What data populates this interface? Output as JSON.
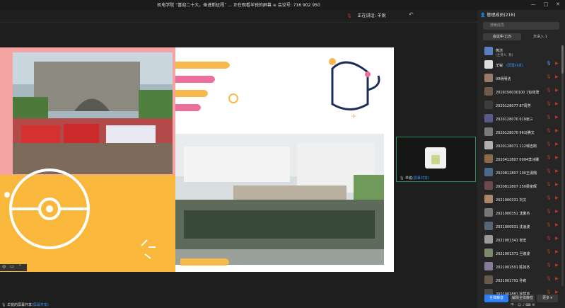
{
  "window": {
    "title": "机电学院 “喜迎二十大，奋进新征程” ... 正在观看羊锐的屏幕  ≡  会议号: 716 902 950",
    "minimize": "—",
    "maximize": "□",
    "close": "✕"
  },
  "top": {
    "speaking_label": "正在讲话: 羊锐",
    "undo_icon": "↶"
  },
  "selfview": {
    "name": "羊锐",
    "sharing_tag": "(屏幕共享)"
  },
  "status": {
    "text": "羊锐的屏幕共享",
    "tag": "(屏幕共享)"
  },
  "bottom_left_icons": [
    "◎",
    "▭",
    "⌃"
  ],
  "panel": {
    "title": "管理成员(216)",
    "search_placeholder": "搜索成员",
    "tab_in_meeting": "会议中·215",
    "tab_not_joined": "未进入·1",
    "members": [
      {
        "name": "熊洁",
        "sub": "(主持人, 我)",
        "avatar": "#5a7fbf"
      },
      {
        "name": "羊锐",
        "sub": "(屏幕共享)",
        "avatar": "#dcdcdc",
        "tag": true
      },
      {
        "name": "09杨明洁",
        "sub": "",
        "avatar": "#9a7b6b"
      },
      {
        "name": "2019156030100 1包佳澄",
        "sub": "",
        "avatar": "#6d5a4a"
      },
      {
        "name": "2020128077 87周芳",
        "sub": "",
        "avatar": "#3c3c3c"
      },
      {
        "name": "2020128070 019张三",
        "sub": "",
        "avatar": "#5a5a8a"
      },
      {
        "name": "2020128070 96马腾文",
        "sub": "",
        "avatar": "#7a7a7a"
      },
      {
        "name": "2020128071 112邹吉刚",
        "sub": "",
        "avatar": "#b0b0b0"
      },
      {
        "name": "2020412807 0094李冰娜",
        "sub": "",
        "avatar": "#8a6a4a"
      },
      {
        "name": "2020812807 100王潇翔",
        "sub": "",
        "avatar": "#4a6a8a"
      },
      {
        "name": "2020812807 250梁家辉",
        "sub": "",
        "avatar": "#6a4a4a"
      },
      {
        "name": "2021000331 刘文",
        "sub": "",
        "avatar": "#aa8866"
      },
      {
        "name": "2021000351 沈鹏杰",
        "sub": "",
        "avatar": "#777777"
      },
      {
        "name": "2021000931 沈凌波",
        "sub": "",
        "avatar": "#556677"
      },
      {
        "name": "2021001341 张宏",
        "sub": "",
        "avatar": "#9a9a9a"
      },
      {
        "name": "2021001371 旦淑波",
        "sub": "",
        "avatar": "#7a8a6a"
      },
      {
        "name": "2021001501 陈如杰",
        "sub": "",
        "avatar": "#8a7a9a"
      },
      {
        "name": "2021001791 孙莉",
        "sub": "",
        "avatar": "#6a5a4a"
      },
      {
        "name": "2021001881 徐慧苗",
        "sub": "",
        "avatar": "#4a4a4a"
      }
    ],
    "member_tag": "(屏幕共享)",
    "mute_all": "全体静音",
    "unmute_all": "解除全体静音",
    "more": "更多 ▾",
    "bottom_icons": "中 · ☺ ♪ ⌨ ⚙"
  }
}
